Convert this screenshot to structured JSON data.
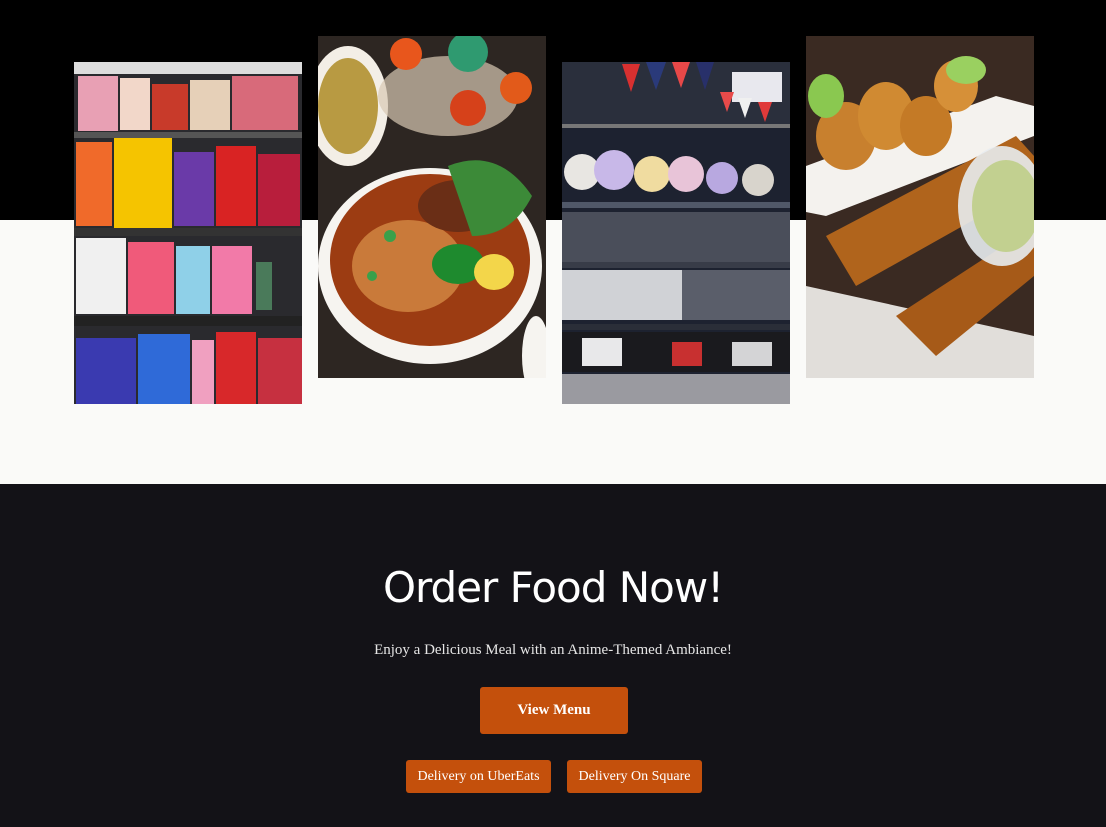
{
  "gallery": {
    "photos": [
      {
        "alt": "snack-shelf-photo",
        "icon": "snack-shelf-image"
      },
      {
        "alt": "pho-bowl-photo",
        "icon": "noodle-soup-image"
      },
      {
        "alt": "anime-merch-photo",
        "icon": "merchandise-shelf-image"
      },
      {
        "alt": "fried-food-photo",
        "icon": "egg-rolls-image"
      }
    ]
  },
  "order": {
    "title": "Order Food Now!",
    "subtitle": "Enjoy a Delicious Meal with an Anime-Themed Ambiance!",
    "view_menu_label": "View Menu",
    "ubereats_label": "Delivery on UberEats",
    "square_label": "Delivery On Square"
  },
  "colors": {
    "accent": "#c4500c",
    "dark_bg": "#131217",
    "top_band": "#000000",
    "light_bg": "#fafaf8"
  }
}
